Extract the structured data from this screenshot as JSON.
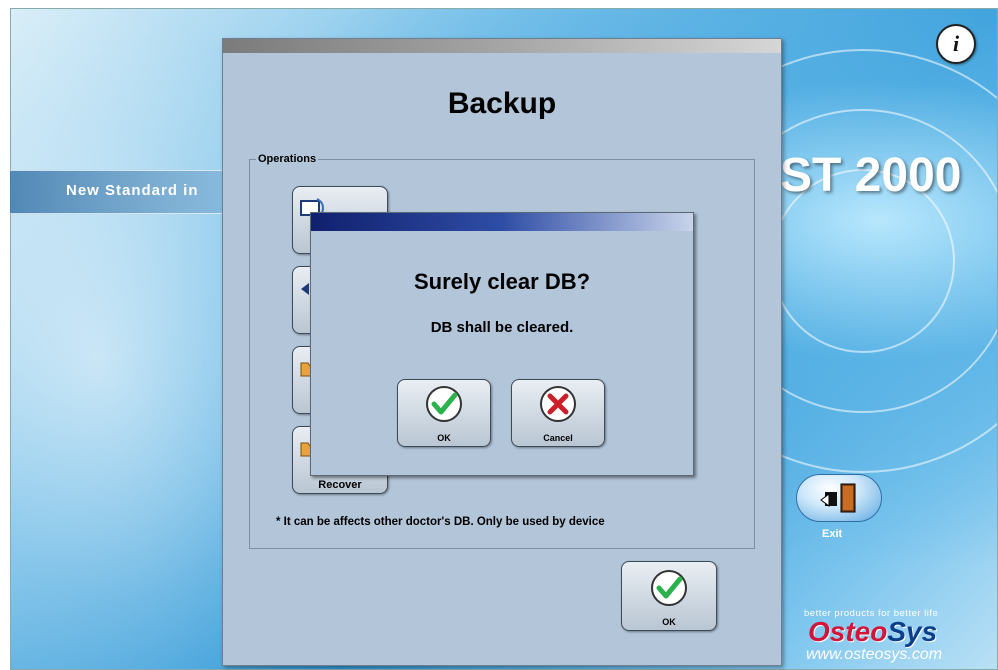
{
  "app": {
    "banner_text": "New Standard in",
    "product_text": "ST 2000",
    "info_icon": "info-icon",
    "exit_label": "Exit",
    "tagline": "better products for better life",
    "brand": {
      "part1": "Osteo",
      "part2": "Sys"
    },
    "url": "www.osteosys.com"
  },
  "backup_window": {
    "title": "Backup",
    "group_label": "Operations",
    "op_buttons": [
      {
        "label": "",
        "icon": "backup-icon"
      },
      {
        "label": "",
        "icon": "restore-icon"
      },
      {
        "label": "",
        "icon": "folder-icon"
      },
      {
        "label": "Recover",
        "icon": "folder-icon"
      }
    ],
    "note": "* It can be affects other doctor's DB. Only be used by device",
    "ok_label": "OK"
  },
  "dialog": {
    "title": "Surely clear DB?",
    "message": "DB shall be cleared.",
    "ok_label": "OK",
    "cancel_label": "Cancel"
  },
  "colors": {
    "window_bg": "#b3c5d9",
    "dialog_titlebar": "#10206e",
    "brand_red": "#d2153a",
    "brand_blue": "#0b3f8c",
    "check_green": "#2bb24c",
    "cancel_red": "#cc1f2a"
  }
}
